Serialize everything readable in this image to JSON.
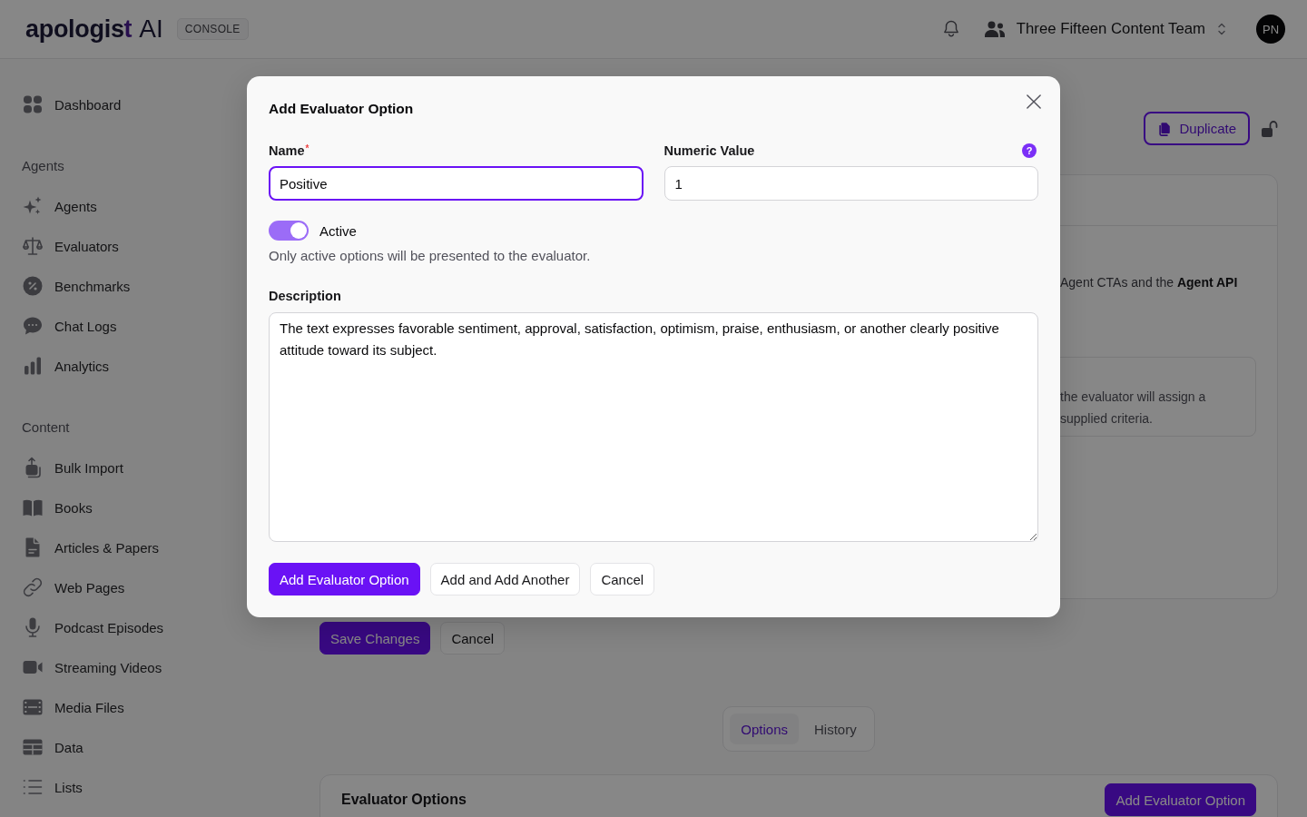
{
  "header": {
    "logo": {
      "wordmark": "apologis",
      "accent": "t",
      "suffix": "AI"
    },
    "badge": "CONSOLE",
    "team": "Three Fifteen Content Team",
    "avatar": "PN"
  },
  "sidebar": {
    "top": [
      {
        "label": "Dashboard"
      }
    ],
    "sections": [
      {
        "title": "Agents",
        "items": [
          {
            "label": "Agents"
          },
          {
            "label": "Evaluators"
          },
          {
            "label": "Benchmarks"
          },
          {
            "label": "Chat Logs"
          },
          {
            "label": "Analytics"
          }
        ]
      },
      {
        "title": "Content",
        "items": [
          {
            "label": "Bulk Import"
          },
          {
            "label": "Books"
          },
          {
            "label": "Articles & Papers"
          },
          {
            "label": "Web Pages"
          },
          {
            "label": "Podcast Episodes"
          },
          {
            "label": "Streaming Videos"
          },
          {
            "label": "Media Files"
          },
          {
            "label": "Data"
          },
          {
            "label": "Lists"
          }
        ]
      }
    ]
  },
  "page": {
    "duplicate_button": "Duplicate",
    "evaluator_card": {
      "text": "Agent CTAs and the **Agent API**",
      "note_lines": [
        "the evaluator will assign a",
        "supplied criteria."
      ]
    },
    "actions": [
      {
        "label": "Save Changes",
        "kind": "primary"
      },
      {
        "label": "Cancel",
        "kind": "secondary"
      }
    ],
    "tabs": [
      {
        "label": "Options",
        "selected": true
      },
      {
        "label": "History",
        "selected": false
      }
    ],
    "options_card": {
      "title": "Evaluator Options",
      "button": {
        "label": "Add Evaluator Option",
        "kind": "primary"
      }
    }
  },
  "modal": {
    "title": "Add Evaluator Option",
    "fields": [
      {
        "label": "Name",
        "required_mark": "*",
        "value": "Positive",
        "focused": true
      },
      {
        "label": "Numeric Value",
        "help": "?",
        "value": "1",
        "focused": false
      }
    ],
    "toggle": {
      "label": "Active",
      "on": true,
      "hint": "Only active options will be presented to the evaluator."
    },
    "description": {
      "label": "Description",
      "value": "The text expresses favorable sentiment, approval, satisfaction, optimism, praise, enthusiasm, or another clearly positive attitude toward its subject."
    },
    "buttons": [
      {
        "label": "Add Evaluator Option",
        "kind": "primary"
      },
      {
        "label": "Add and Add Another",
        "kind": "secondary"
      },
      {
        "label": "Cancel",
        "kind": "secondary"
      }
    ]
  }
}
